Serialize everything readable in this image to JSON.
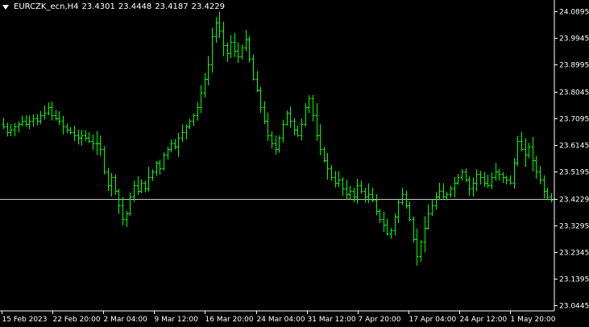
{
  "header": {
    "symbol": "EURCZK_ecn,H4",
    "open": "23.4301",
    "high": "23.4448",
    "low": "23.4187",
    "close": "23.4229"
  },
  "chart_data": {
    "type": "ohlc",
    "ylim": [
      23.025,
      24.115
    ],
    "yticks": [
      "24.0895",
      "23.9945",
      "23.8995",
      "23.8045",
      "23.7095",
      "23.6145",
      "23.5195",
      "23.4229",
      "23.3295",
      "23.2345",
      "23.1395",
      "23.0445"
    ],
    "current_price": "23.4229",
    "xticks": [
      "15 Feb 2023",
      "22 Feb 20:00",
      "2 Mar 04:00",
      "9 Mar 12:00",
      "16 Mar 20:00",
      "24 Mar 04:00",
      "31 Mar 12:00",
      "7 Apr 20:00",
      "17 Apr 04:00",
      "24 Apr 12:00",
      "1 May 20:00"
    ],
    "colors": {
      "bars": "#00ff00",
      "grid_line": "#c8c8c8",
      "text": "#ffffff",
      "background": "#000000"
    },
    "close_series": [
      23.68,
      23.66,
      23.67,
      23.68,
      23.69,
      23.7,
      23.69,
      23.7,
      23.71,
      23.7,
      23.72,
      23.73,
      23.75,
      23.72,
      23.71,
      23.7,
      23.68,
      23.67,
      23.66,
      23.65,
      23.64,
      23.65,
      23.64,
      23.63,
      23.62,
      23.62,
      23.6,
      23.52,
      23.47,
      23.5,
      23.45,
      23.4,
      23.35,
      23.37,
      23.43,
      23.47,
      23.45,
      23.48,
      23.46,
      23.5,
      23.52,
      23.55,
      23.53,
      23.58,
      23.6,
      23.62,
      23.61,
      23.64,
      23.66,
      23.68,
      23.7,
      23.72,
      23.75,
      23.8,
      23.85,
      23.9,
      24.0,
      24.05,
      24.02,
      23.97,
      23.94,
      23.98,
      23.95,
      23.93,
      23.96,
      23.99,
      23.92,
      23.85,
      23.81,
      23.75,
      23.7,
      23.65,
      23.62,
      23.6,
      23.64,
      23.69,
      23.73,
      23.7,
      23.67,
      23.65,
      23.69,
      23.75,
      23.78,
      23.72,
      23.65,
      23.6,
      23.56,
      23.53,
      23.5,
      23.48,
      23.49,
      23.46,
      23.44,
      23.45,
      23.43,
      23.47,
      23.45,
      23.43,
      23.44,
      23.42,
      23.38,
      23.35,
      23.33,
      23.3,
      23.31,
      23.36,
      23.41,
      23.44,
      23.4,
      23.35,
      23.28,
      23.22,
      23.27,
      23.32,
      23.37,
      23.4,
      23.43,
      23.45,
      23.43,
      23.44,
      23.46,
      23.48,
      23.5,
      23.52,
      23.49,
      23.46,
      23.48,
      23.51,
      23.5,
      23.48,
      23.47,
      23.5,
      23.52,
      23.51,
      23.5,
      23.49,
      23.48,
      23.55,
      23.63,
      23.6,
      23.58,
      23.61,
      23.56,
      23.52,
      23.49,
      23.45,
      23.43,
      23.42
    ]
  }
}
